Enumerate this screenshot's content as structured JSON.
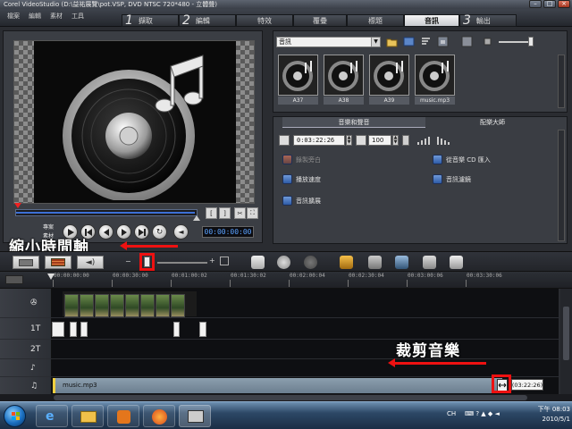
{
  "window": {
    "title": "Corel VideoStudio (D:\\益祐展覽\\pot.VSP, DVD NTSC 720*480 - 立體聲)"
  },
  "menu": [
    "檔案",
    "編輯",
    "素材",
    "工具"
  ],
  "steps": [
    {
      "num": "1",
      "label": "擷取"
    },
    {
      "num": "2",
      "label": "編輯"
    },
    {
      "num": "",
      "label": "特效"
    },
    {
      "num": "",
      "label": "覆疊"
    },
    {
      "num": "",
      "label": "標題"
    },
    {
      "num": "",
      "label": "音訊",
      "active": true
    },
    {
      "num": "3",
      "label": "輸出"
    }
  ],
  "preview": {
    "mode_labels": [
      "專案",
      "素材"
    ],
    "timecode": "00:00:00:00",
    "markers": [
      "[",
      "]"
    ]
  },
  "library": {
    "category": "音訊",
    "items": [
      "A37",
      "A38",
      "A39",
      "music.mp3"
    ]
  },
  "options": {
    "tabs": [
      "音樂和聲音",
      "配樂大師"
    ],
    "duration": "0:03:22:26",
    "volume": "100",
    "left_actions": [
      "錄製旁白",
      "播放速度",
      "音訊擴展"
    ],
    "right_actions": [
      "從音樂 CD 匯入",
      "音訊濾鏡"
    ]
  },
  "annotations": {
    "zoom_out_timeline": "縮小時間軸",
    "trim_music": "裁剪音樂"
  },
  "ruler": {
    "ticks": [
      "00:00:00:00",
      "00:00:30:00",
      "00:01:00:02",
      "00:01:30:02",
      "00:02:00:04",
      "00:02:30:04",
      "00:03:00:06",
      "00:03:30:06"
    ]
  },
  "tracks": {
    "title_tracks": [
      "1T",
      "2T"
    ],
    "music_clip": "music.mp3",
    "music_duration": "(03:22:26)"
  },
  "taskbar": {
    "tray_lang": "CH",
    "time": "下午 08:03",
    "date": "2010/5/1"
  },
  "colors": {
    "accent_red": "#e11111",
    "scrub_blue": "#3c6fd6",
    "timecode_blue": "#5aa2ff"
  }
}
